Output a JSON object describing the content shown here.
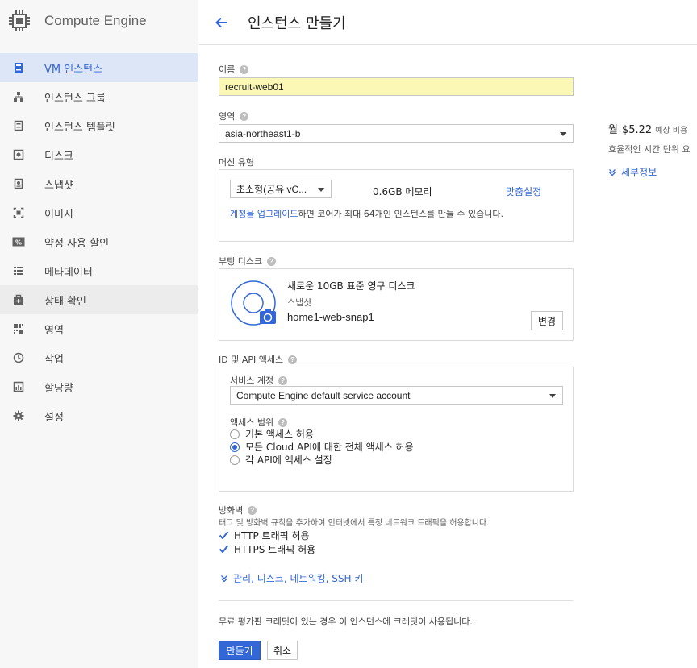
{
  "app": {
    "title": "Compute Engine"
  },
  "sidebar": {
    "items": [
      {
        "label": "VM 인스턴스",
        "icon": "vm-instances-icon"
      },
      {
        "label": "인스턴스 그룹",
        "icon": "instance-groups-icon"
      },
      {
        "label": "인스턴스 템플릿",
        "icon": "instance-templates-icon"
      },
      {
        "label": "디스크",
        "icon": "disk-icon"
      },
      {
        "label": "스냅샷",
        "icon": "snapshot-icon"
      },
      {
        "label": "이미지",
        "icon": "images-icon"
      },
      {
        "label": "약정 사용 할인",
        "icon": "discount-icon"
      },
      {
        "label": "메타데이터",
        "icon": "metadata-icon"
      },
      {
        "label": "상태 확인",
        "icon": "health-check-icon"
      },
      {
        "label": "영역",
        "icon": "zones-icon"
      },
      {
        "label": "작업",
        "icon": "operations-icon"
      },
      {
        "label": "할당량",
        "icon": "quotas-icon"
      },
      {
        "label": "설정",
        "icon": "settings-icon"
      }
    ]
  },
  "header": {
    "title": "인스턴스 만들기"
  },
  "form": {
    "name": {
      "label": "이름",
      "value": "recruit-web01"
    },
    "zone": {
      "label": "영역",
      "value": "asia-northeast1-b"
    },
    "machine": {
      "label": "머신 유형",
      "type_value": "초소형(공유 vC...",
      "memory": "0.6GB 메모리",
      "customize": "맞춤설정",
      "upgrade_link": "계정을 업그레이드",
      "upgrade_text": "하면 코어가 최대 64개인 인스턴스를 만들 수 있습니다."
    },
    "boot_disk": {
      "label": "부팅 디스크",
      "title": "새로운 10GB 표준 영구 디스크",
      "snapshot_label": "스냅샷",
      "snapshot_name": "home1-web-snap1",
      "change_button": "변경"
    },
    "identity": {
      "label": "ID 및 API 액세스",
      "service_account_label": "서비스 계정",
      "service_account_value": "Compute Engine default service account",
      "scope_label": "액세스 범위",
      "scopes": [
        {
          "label": "기본 액세스 허용",
          "selected": false
        },
        {
          "label": "모든 Cloud API에 대한 전체 액세스 허용",
          "selected": true
        },
        {
          "label": "각 API에 액세스 설정",
          "selected": false
        }
      ]
    },
    "firewall": {
      "label": "방화벽",
      "description": "태그 및 방화벽 규칙을 추가하여 인터넷에서 특정 네트워크 트래픽을 허용합니다.",
      "options": [
        {
          "label": "HTTP 트래픽 허용",
          "checked": true
        },
        {
          "label": "HTTPS 트래픽 허용",
          "checked": true
        }
      ]
    },
    "advanced_link": "관리, 디스크, 네트워킹, SSH 키",
    "credit_note": "무료 평가판 크레딧이 있는 경우 이 인스턴스에 크레딧이 사용됩니다.",
    "create_button": "만들기",
    "cancel_button": "취소"
  },
  "cost": {
    "month_label": "월",
    "amount": "$5.22",
    "estimate_label": "예상 비용",
    "effective_text": "효율적인 시간 단위 요",
    "details_link": "세부정보"
  },
  "colors": {
    "accent": "#3367d6",
    "name_field_bg": "#fbf8b6"
  }
}
